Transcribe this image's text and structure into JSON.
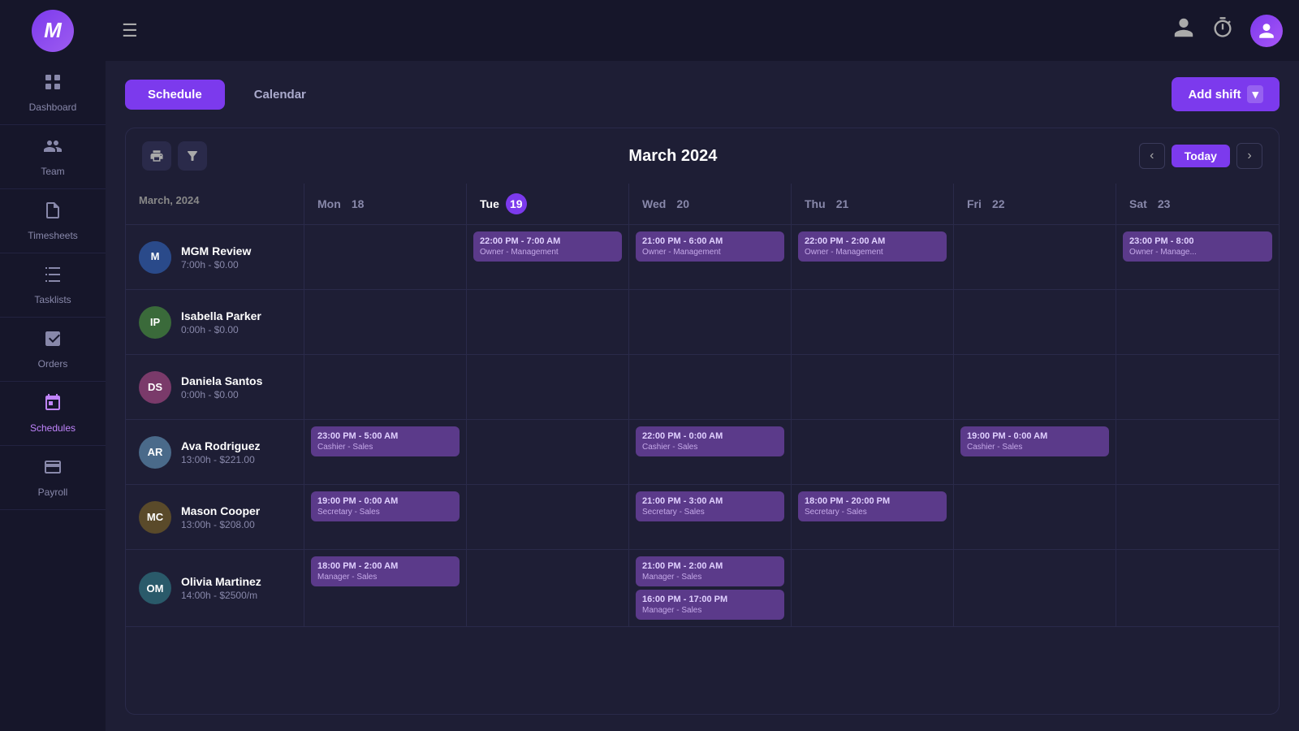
{
  "sidebar": {
    "logo": "M",
    "items": [
      {
        "id": "dashboard",
        "label": "Dashboard",
        "icon": "📊",
        "active": false
      },
      {
        "id": "team",
        "label": "Team",
        "icon": "👥",
        "active": false
      },
      {
        "id": "timesheets",
        "label": "Timesheets",
        "icon": "🗒️",
        "active": false
      },
      {
        "id": "tasklists",
        "label": "Tasklists",
        "icon": "✅",
        "active": false
      },
      {
        "id": "orders",
        "label": "Orders",
        "icon": "📦",
        "active": false
      },
      {
        "id": "schedules",
        "label": "Schedules",
        "icon": "📅",
        "active": true
      },
      {
        "id": "payroll",
        "label": "Payroll",
        "icon": "💰",
        "active": false
      }
    ]
  },
  "topbar": {
    "hamburger": "☰",
    "user_icon": "👤",
    "timer_icon": "⏱",
    "avatar_initials": "U"
  },
  "tabs": [
    {
      "id": "schedule",
      "label": "Schedule",
      "active": true
    },
    {
      "id": "calendar",
      "label": "Calendar",
      "active": false
    }
  ],
  "add_shift_label": "Add shift",
  "schedule_title": "March 2024",
  "today_label": "Today",
  "month_label": "March, 2024",
  "day_headers": [
    {
      "day": "Mon",
      "num": "18",
      "today": false
    },
    {
      "day": "Tue",
      "num": "19",
      "today": true
    },
    {
      "day": "Wed",
      "num": "20",
      "today": false
    },
    {
      "day": "Thu",
      "num": "21",
      "today": false
    },
    {
      "day": "Fri",
      "num": "22",
      "today": false
    },
    {
      "day": "Sat",
      "num": "23",
      "today": false
    }
  ],
  "employees": [
    {
      "id": "mgm",
      "name": "MGM Review",
      "hours": "7:00h - $0.00",
      "avatar_initials": "",
      "avatar_img": true,
      "avatar_class": "av-mgm",
      "shifts": {
        "mon": null,
        "tue": {
          "time": "22:00 PM - 7:00 AM",
          "role": "Owner - Management"
        },
        "wed": {
          "time": "21:00 PM - 6:00 AM",
          "role": "Owner - Management"
        },
        "thu": {
          "time": "22:00 PM - 2:00 AM",
          "role": "Owner - Management"
        },
        "fri": null,
        "sat": {
          "time": "23:00 PM - 8:00",
          "role": "Owner - Manage..."
        }
      }
    },
    {
      "id": "ip",
      "name": "Isabella Parker",
      "hours": "0:00h - $0.00",
      "avatar_initials": "IP",
      "avatar_img": false,
      "avatar_class": "av-ip",
      "shifts": {
        "mon": null,
        "tue": null,
        "wed": null,
        "thu": null,
        "fri": null,
        "sat": null
      }
    },
    {
      "id": "ds",
      "name": "Daniela Santos",
      "hours": "0:00h - $0.00",
      "avatar_initials": "DS",
      "avatar_img": false,
      "avatar_class": "av-ds",
      "shifts": {
        "mon": null,
        "tue": null,
        "wed": null,
        "thu": null,
        "fri": null,
        "sat": null
      }
    },
    {
      "id": "ar",
      "name": "Ava Rodriguez",
      "hours": "13:00h - $221.00",
      "avatar_initials": "AR",
      "avatar_img": false,
      "avatar_class": "av-ar",
      "shifts": {
        "mon": {
          "time": "23:00 PM - 5:00 AM",
          "role": "Cashier - Sales"
        },
        "tue": null,
        "wed": {
          "time": "22:00 PM - 0:00 AM",
          "role": "Cashier - Sales"
        },
        "thu": null,
        "fri": {
          "time": "19:00 PM - 0:00 AM",
          "role": "Cashier - Sales"
        },
        "sat": null
      }
    },
    {
      "id": "mc",
      "name": "Mason Cooper",
      "hours": "13:00h - $208.00",
      "avatar_initials": "MC",
      "avatar_img": false,
      "avatar_class": "av-mc",
      "shifts": {
        "mon": {
          "time": "19:00 PM - 0:00 AM",
          "role": "Secretary - Sales"
        },
        "tue": null,
        "wed": {
          "time": "21:00 PM - 3:00 AM",
          "role": "Secretary - Sales"
        },
        "thu": {
          "time": "18:00 PM - 20:00 PM",
          "role": "Secretary - Sales"
        },
        "fri": null,
        "sat": null
      }
    },
    {
      "id": "om",
      "name": "Olivia Martinez",
      "hours": "14:00h - $2500/m",
      "avatar_initials": "OM",
      "avatar_img": false,
      "avatar_class": "av-om",
      "shifts": {
        "mon": {
          "time": "18:00 PM - 2:00 AM",
          "role": "Manager - Sales"
        },
        "tue": null,
        "wed_1": {
          "time": "21:00 PM - 2:00 AM",
          "role": "Manager - Sales"
        },
        "wed_2": {
          "time": "16:00 PM - 17:00 PM",
          "role": "Manager - Sales"
        },
        "thu": null,
        "fri": null,
        "sat": null
      }
    }
  ]
}
